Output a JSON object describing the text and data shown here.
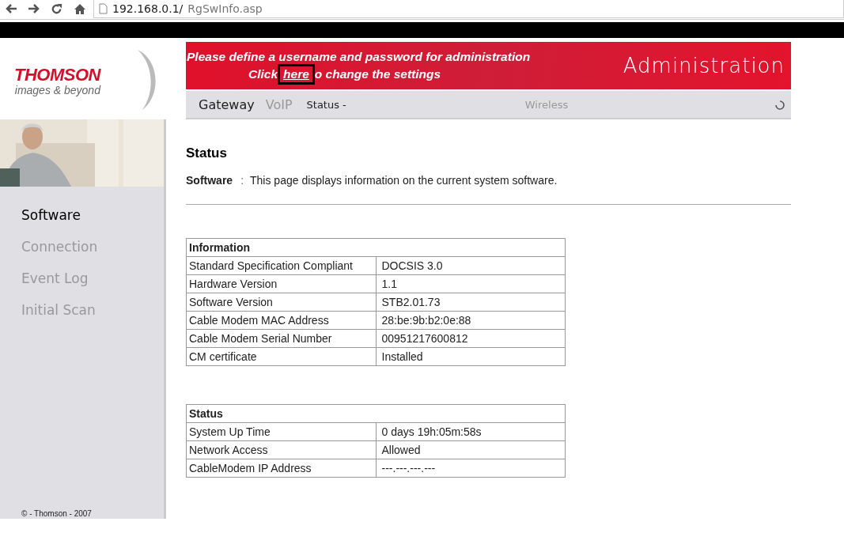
{
  "browser": {
    "url_host": "192.168.0.1/",
    "url_path": "RgSwInfo.asp"
  },
  "header": {
    "logo": "THOMSON",
    "tagline": "images & beyond",
    "notice_line_1": "Please define a username and password for administration",
    "notice_line_2_before": "Click",
    "notice_link": "here",
    "notice_line_2_after": "o change the settings",
    "link_highlighted": true,
    "title": "Administration"
  },
  "nav": [
    {
      "label": "Gateway",
      "kind": "main",
      "active": true
    },
    {
      "label": "VoIP",
      "kind": "main",
      "active": false
    },
    {
      "label": "Status -",
      "kind": "sub",
      "active": true
    },
    {
      "label": "Wireless",
      "kind": "far",
      "active": false
    }
  ],
  "sidebar": {
    "items": [
      {
        "label": "Software",
        "selected": true
      },
      {
        "label": "Connection",
        "selected": false
      },
      {
        "label": "Event Log",
        "selected": false
      },
      {
        "label": "Initial Scan",
        "selected": false
      }
    ],
    "footer": "© - Thomson - 2007"
  },
  "page": {
    "title": "Status",
    "subject": "Software",
    "separator": ":",
    "description": "This page displays information on the current system software."
  },
  "tables": [
    {
      "title": "Information",
      "rows": [
        [
          "Standard Specification Compliant",
          "DOCSIS 3.0"
        ],
        [
          "Hardware Version",
          "1.1"
        ],
        [
          "Software Version",
          "STB2.01.73"
        ],
        [
          "Cable Modem MAC Address",
          "28:be:9b:b2:0e:88"
        ],
        [
          "Cable Modem Serial Number",
          "00951217600812"
        ],
        [
          "CM certificate",
          "Installed"
        ]
      ]
    },
    {
      "title": "Status",
      "rows": [
        [
          "System Up Time",
          "0 days 19h:05m:58s"
        ],
        [
          "Network Access",
          "Allowed"
        ],
        [
          "CableModem IP Address",
          "---.---.---.---"
        ]
      ]
    }
  ]
}
